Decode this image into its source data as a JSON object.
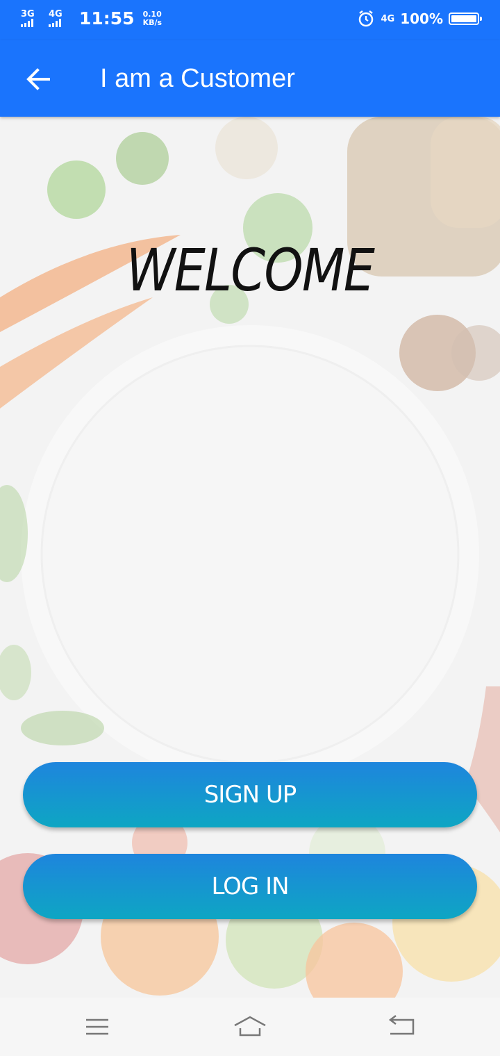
{
  "status_bar": {
    "network_1": "3G",
    "network_2": "4G",
    "time": "11:55",
    "speed_value": "0.10",
    "speed_unit": "KB/s",
    "lte": "4G",
    "battery_percent": "100%",
    "battery_level": 1.0,
    "icons": [
      "signal-icon",
      "signal-icon",
      "alarm-icon",
      "battery-icon"
    ]
  },
  "app_bar": {
    "title": "I am a Customer",
    "back_icon": "arrow-left-icon",
    "color": "#1a74fd"
  },
  "main": {
    "welcome_text": "WELCOME",
    "signup_label": "SIGN UP",
    "login_label": "LOG IN",
    "button_colors": [
      "#1e85dd",
      "#0ea6c3"
    ]
  },
  "nav_bar": {
    "icons": [
      "menu-icon",
      "home-icon",
      "back-icon"
    ]
  }
}
